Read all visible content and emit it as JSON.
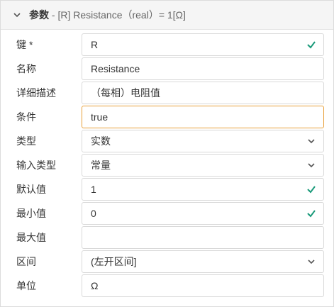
{
  "header": {
    "title_strong": "参数",
    "title_rest": " - [R] Resistance（real）= 1[Ω]",
    "toggle_icon": "chevron-down-icon"
  },
  "colors": {
    "check": "#1a9a7a",
    "focus_border": "#e8a03a",
    "chevron": "#555555"
  },
  "fields": {
    "key": {
      "label": "键",
      "required_mark": "*",
      "value": "R",
      "icon": "check-icon"
    },
    "name": {
      "label": "名称",
      "value": "Resistance"
    },
    "description": {
      "label": "详细描述",
      "value": "（每相）电阻值"
    },
    "condition": {
      "label": "条件",
      "value": "true"
    },
    "type": {
      "label": "类型",
      "value": "实数",
      "icon": "chevron-down-icon"
    },
    "input_type": {
      "label": "输入类型",
      "value": "常量",
      "icon": "chevron-down-icon"
    },
    "default": {
      "label": "默认值",
      "value": "1",
      "icon": "check-icon"
    },
    "min": {
      "label": "最小值",
      "value": "0",
      "icon": "check-icon"
    },
    "max": {
      "label": "最大值",
      "value": ""
    },
    "interval": {
      "label": "区间",
      "value": "(左开区间]",
      "icon": "chevron-down-icon"
    },
    "unit": {
      "label": "单位",
      "value": "Ω"
    }
  }
}
